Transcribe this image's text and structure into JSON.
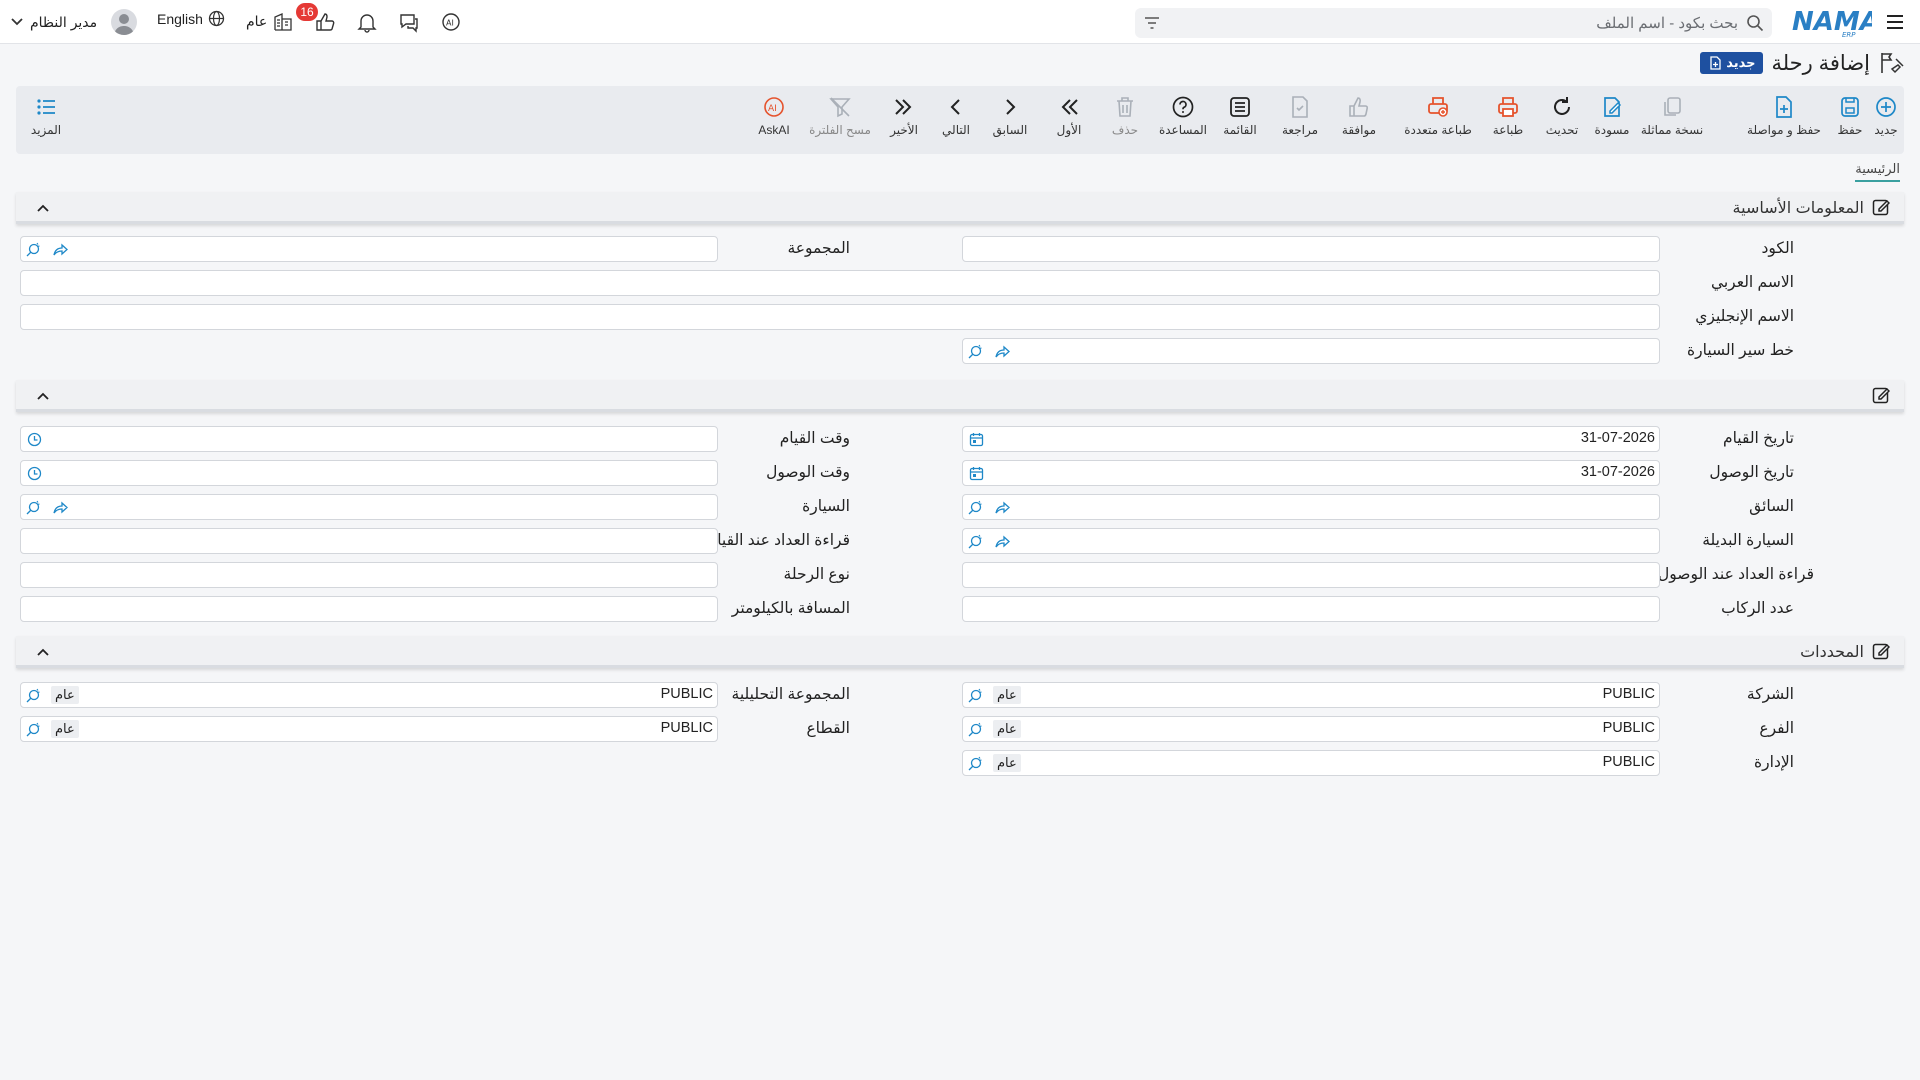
{
  "topbar": {
    "search_placeholder": "بحث بكود - اسم الملف",
    "user_name": "مدير النظام",
    "language": "English",
    "company": "عام",
    "notification_count": "16"
  },
  "page": {
    "title": "إضافة رحلة",
    "new_badge": "جديد"
  },
  "toolbar": {
    "new": "جديد",
    "save": "حفظ",
    "save_continue": "حفظ و مواصلة",
    "duplicate": "نسخة مماثلة",
    "draft": "مسودة",
    "refresh": "تحديث",
    "print": "طباعة",
    "multi_print": "طباعة متعددة",
    "approve": "موافقة",
    "review": "مراجعة",
    "list": "القائمة",
    "help": "المساعدة",
    "delete": "حذف",
    "first": "الأول",
    "previous": "السابق",
    "next": "التالي",
    "last": "الأخير",
    "clear_filter": "مسح الفلترة",
    "askai": "AskAI",
    "more": "المزيد"
  },
  "tabs": {
    "main": "الرئيسية"
  },
  "basic_info": {
    "title": "المعلومات الأساسية",
    "code_label": "الكود",
    "group_label": "المجموعة",
    "arabic_name_label": "الاسم العربي",
    "english_name_label": "الاسم الإنجليزي",
    "route_label": "خط سير السيارة"
  },
  "trip": {
    "departure_date_label": "تاريخ القيام",
    "departure_date_value": "31-07-2026",
    "departure_time_label": "وقت القيام",
    "arrival_date_label": "تاريخ الوصول",
    "arrival_date_value": "31-07-2026",
    "arrival_time_label": "وقت الوصول",
    "driver_label": "السائق",
    "car_label": "السيارة",
    "alt_car_label": "السيارة البديلة",
    "odometer_departure_label": "قراءة العداد عند القيام",
    "odometer_arrival_label": "قراءة العداد عند الوصول",
    "trip_type_label": "نوع الرحلة",
    "passengers_label": "عدد الركاب",
    "distance_label": "المسافة بالكيلومتر"
  },
  "dimensions": {
    "title": "المحددات",
    "company_label": "الشركة",
    "analytic_group_label": "المجموعة التحليلية",
    "branch_label": "الفرع",
    "sector_label": "القطاع",
    "department_label": "الإدارة",
    "value": "PUBLIC",
    "tag": "عام"
  },
  "colors": {
    "accent_blue": "#1e88c8",
    "brand_blue": "#1e50a0",
    "print_orange": "#e5532d",
    "badge_red": "#e53935"
  }
}
